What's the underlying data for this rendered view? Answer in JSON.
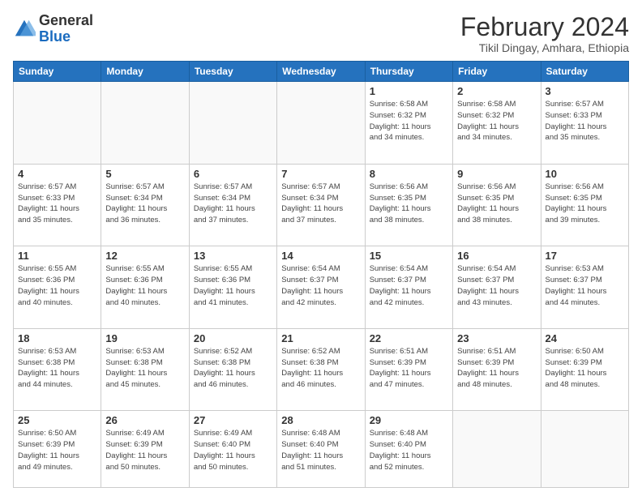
{
  "header": {
    "logo_line1": "General",
    "logo_line2": "Blue",
    "month": "February 2024",
    "location": "Tikil Dingay, Amhara, Ethiopia"
  },
  "weekdays": [
    "Sunday",
    "Monday",
    "Tuesday",
    "Wednesday",
    "Thursday",
    "Friday",
    "Saturday"
  ],
  "weeks": [
    [
      {
        "day": "",
        "info": ""
      },
      {
        "day": "",
        "info": ""
      },
      {
        "day": "",
        "info": ""
      },
      {
        "day": "",
        "info": ""
      },
      {
        "day": "1",
        "info": "Sunrise: 6:58 AM\nSunset: 6:32 PM\nDaylight: 11 hours\nand 34 minutes."
      },
      {
        "day": "2",
        "info": "Sunrise: 6:58 AM\nSunset: 6:32 PM\nDaylight: 11 hours\nand 34 minutes."
      },
      {
        "day": "3",
        "info": "Sunrise: 6:57 AM\nSunset: 6:33 PM\nDaylight: 11 hours\nand 35 minutes."
      }
    ],
    [
      {
        "day": "4",
        "info": "Sunrise: 6:57 AM\nSunset: 6:33 PM\nDaylight: 11 hours\nand 35 minutes."
      },
      {
        "day": "5",
        "info": "Sunrise: 6:57 AM\nSunset: 6:34 PM\nDaylight: 11 hours\nand 36 minutes."
      },
      {
        "day": "6",
        "info": "Sunrise: 6:57 AM\nSunset: 6:34 PM\nDaylight: 11 hours\nand 37 minutes."
      },
      {
        "day": "7",
        "info": "Sunrise: 6:57 AM\nSunset: 6:34 PM\nDaylight: 11 hours\nand 37 minutes."
      },
      {
        "day": "8",
        "info": "Sunrise: 6:56 AM\nSunset: 6:35 PM\nDaylight: 11 hours\nand 38 minutes."
      },
      {
        "day": "9",
        "info": "Sunrise: 6:56 AM\nSunset: 6:35 PM\nDaylight: 11 hours\nand 38 minutes."
      },
      {
        "day": "10",
        "info": "Sunrise: 6:56 AM\nSunset: 6:35 PM\nDaylight: 11 hours\nand 39 minutes."
      }
    ],
    [
      {
        "day": "11",
        "info": "Sunrise: 6:55 AM\nSunset: 6:36 PM\nDaylight: 11 hours\nand 40 minutes."
      },
      {
        "day": "12",
        "info": "Sunrise: 6:55 AM\nSunset: 6:36 PM\nDaylight: 11 hours\nand 40 minutes."
      },
      {
        "day": "13",
        "info": "Sunrise: 6:55 AM\nSunset: 6:36 PM\nDaylight: 11 hours\nand 41 minutes."
      },
      {
        "day": "14",
        "info": "Sunrise: 6:54 AM\nSunset: 6:37 PM\nDaylight: 11 hours\nand 42 minutes."
      },
      {
        "day": "15",
        "info": "Sunrise: 6:54 AM\nSunset: 6:37 PM\nDaylight: 11 hours\nand 42 minutes."
      },
      {
        "day": "16",
        "info": "Sunrise: 6:54 AM\nSunset: 6:37 PM\nDaylight: 11 hours\nand 43 minutes."
      },
      {
        "day": "17",
        "info": "Sunrise: 6:53 AM\nSunset: 6:37 PM\nDaylight: 11 hours\nand 44 minutes."
      }
    ],
    [
      {
        "day": "18",
        "info": "Sunrise: 6:53 AM\nSunset: 6:38 PM\nDaylight: 11 hours\nand 44 minutes."
      },
      {
        "day": "19",
        "info": "Sunrise: 6:53 AM\nSunset: 6:38 PM\nDaylight: 11 hours\nand 45 minutes."
      },
      {
        "day": "20",
        "info": "Sunrise: 6:52 AM\nSunset: 6:38 PM\nDaylight: 11 hours\nand 46 minutes."
      },
      {
        "day": "21",
        "info": "Sunrise: 6:52 AM\nSunset: 6:38 PM\nDaylight: 11 hours\nand 46 minutes."
      },
      {
        "day": "22",
        "info": "Sunrise: 6:51 AM\nSunset: 6:39 PM\nDaylight: 11 hours\nand 47 minutes."
      },
      {
        "day": "23",
        "info": "Sunrise: 6:51 AM\nSunset: 6:39 PM\nDaylight: 11 hours\nand 48 minutes."
      },
      {
        "day": "24",
        "info": "Sunrise: 6:50 AM\nSunset: 6:39 PM\nDaylight: 11 hours\nand 48 minutes."
      }
    ],
    [
      {
        "day": "25",
        "info": "Sunrise: 6:50 AM\nSunset: 6:39 PM\nDaylight: 11 hours\nand 49 minutes."
      },
      {
        "day": "26",
        "info": "Sunrise: 6:49 AM\nSunset: 6:39 PM\nDaylight: 11 hours\nand 50 minutes."
      },
      {
        "day": "27",
        "info": "Sunrise: 6:49 AM\nSunset: 6:40 PM\nDaylight: 11 hours\nand 50 minutes."
      },
      {
        "day": "28",
        "info": "Sunrise: 6:48 AM\nSunset: 6:40 PM\nDaylight: 11 hours\nand 51 minutes."
      },
      {
        "day": "29",
        "info": "Sunrise: 6:48 AM\nSunset: 6:40 PM\nDaylight: 11 hours\nand 52 minutes."
      },
      {
        "day": "",
        "info": ""
      },
      {
        "day": "",
        "info": ""
      }
    ]
  ]
}
